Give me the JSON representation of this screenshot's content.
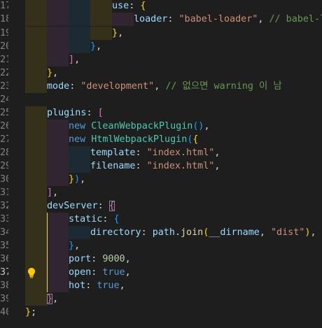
{
  "editor": {
    "line_numbers": [
      "17",
      "18",
      "19",
      "20",
      "21",
      "22",
      "23",
      "24",
      "25",
      "26",
      "27",
      "28",
      "29",
      "30",
      "31",
      "32",
      "33",
      "34",
      "35",
      "36",
      "37",
      "38",
      "39",
      "40"
    ],
    "active_line": "37",
    "gutter_icon": "lightbulb-icon",
    "colors": {
      "background": "#1e1e1e",
      "property": "#9cdcfe",
      "string": "#ce9178",
      "comment": "#6a9955",
      "number": "#b5cea8",
      "keyword": "#569cd6",
      "class": "#4ec9b0",
      "function": "#dcdcaa",
      "bracket_gold": "#ffd700",
      "bracket_orchid": "#da70d6",
      "bracket_blue": "#179fff",
      "lightbulb": "#ffcc00"
    },
    "lines": [
      {
        "tokens": [
          {
            "t": "use",
            "c": "k"
          },
          {
            "t": ": ",
            "c": "pl"
          },
          {
            "t": "{",
            "c": "p1"
          }
        ]
      },
      {
        "tokens": [
          {
            "t": "loader",
            "c": "k"
          },
          {
            "t": ": ",
            "c": "pl"
          },
          {
            "t": "\"babel-loader\"",
            "c": "s"
          },
          {
            "t": ", ",
            "c": "pl"
          },
          {
            "t": "// babel-lo",
            "c": "c"
          }
        ]
      },
      {
        "tokens": [
          {
            "t": "}",
            "c": "p1"
          },
          {
            "t": ",",
            "c": "pl"
          }
        ]
      },
      {
        "tokens": [
          {
            "t": "}",
            "c": "p3"
          },
          {
            "t": ",",
            "c": "pl"
          }
        ]
      },
      {
        "tokens": [
          {
            "t": "]",
            "c": "p2"
          },
          {
            "t": ",",
            "c": "pl"
          }
        ]
      },
      {
        "tokens": [
          {
            "t": "}",
            "c": "p1"
          },
          {
            "t": ",",
            "c": "pl"
          }
        ]
      },
      {
        "tokens": [
          {
            "t": "mode",
            "c": "k"
          },
          {
            "t": ": ",
            "c": "pl"
          },
          {
            "t": "\"development\"",
            "c": "s"
          },
          {
            "t": ", ",
            "c": "pl"
          },
          {
            "t": "// 없으면 warning 이 남",
            "c": "c"
          }
        ]
      },
      {
        "tokens": []
      },
      {
        "tokens": [
          {
            "t": "plugins",
            "c": "k"
          },
          {
            "t": ": ",
            "c": "pl"
          },
          {
            "t": "[",
            "c": "p2"
          }
        ]
      },
      {
        "tokens": [
          {
            "t": "new ",
            "c": "b"
          },
          {
            "t": "CleanWebpackPlugin",
            "c": "cl"
          },
          {
            "t": "()",
            "c": "p3"
          },
          {
            "t": ",",
            "c": "pl"
          }
        ]
      },
      {
        "tokens": [
          {
            "t": "new ",
            "c": "b"
          },
          {
            "t": "HtmlWebpackPlugin",
            "c": "cl"
          },
          {
            "t": "(",
            "c": "p3"
          },
          {
            "t": "{",
            "c": "p1"
          }
        ]
      },
      {
        "tokens": [
          {
            "t": "template",
            "c": "k"
          },
          {
            "t": ": ",
            "c": "pl"
          },
          {
            "t": "\"index.html\"",
            "c": "s"
          },
          {
            "t": ",",
            "c": "pl"
          }
        ]
      },
      {
        "tokens": [
          {
            "t": "filename",
            "c": "k"
          },
          {
            "t": ": ",
            "c": "pl"
          },
          {
            "t": "\"index.html\"",
            "c": "s"
          },
          {
            "t": ",",
            "c": "pl"
          }
        ]
      },
      {
        "tokens": [
          {
            "t": "}",
            "c": "p1"
          },
          {
            "t": ")",
            "c": "p3"
          },
          {
            "t": ",",
            "c": "pl"
          }
        ]
      },
      {
        "tokens": [
          {
            "t": "]",
            "c": "p2"
          },
          {
            "t": ",",
            "c": "pl"
          }
        ]
      },
      {
        "tokens": [
          {
            "t": "devServer",
            "c": "k"
          },
          {
            "t": ": ",
            "c": "pl"
          },
          {
            "t": "{",
            "c": "p2"
          }
        ]
      },
      {
        "tokens": [
          {
            "t": "static",
            "c": "k"
          },
          {
            "t": ": ",
            "c": "pl"
          },
          {
            "t": "{",
            "c": "p3"
          }
        ]
      },
      {
        "tokens": [
          {
            "t": "directory",
            "c": "k"
          },
          {
            "t": ": ",
            "c": "pl"
          },
          {
            "t": "path",
            "c": "v"
          },
          {
            "t": ".",
            "c": "pl"
          },
          {
            "t": "join",
            "c": "f"
          },
          {
            "t": "(",
            "c": "p1"
          },
          {
            "t": "__dirname",
            "c": "v"
          },
          {
            "t": ", ",
            "c": "pl"
          },
          {
            "t": "\"dist\"",
            "c": "s"
          },
          {
            "t": ")",
            "c": "p1"
          },
          {
            "t": ",",
            "c": "pl"
          }
        ]
      },
      {
        "tokens": [
          {
            "t": "}",
            "c": "p3"
          },
          {
            "t": ",",
            "c": "pl"
          }
        ]
      },
      {
        "tokens": [
          {
            "t": "port",
            "c": "k"
          },
          {
            "t": ": ",
            "c": "pl"
          },
          {
            "t": "9000",
            "c": "n"
          },
          {
            "t": ",",
            "c": "pl"
          }
        ]
      },
      {
        "tokens": [
          {
            "t": "open",
            "c": "k"
          },
          {
            "t": ": ",
            "c": "pl"
          },
          {
            "t": "true",
            "c": "b"
          },
          {
            "t": ",",
            "c": "pl"
          }
        ]
      },
      {
        "tokens": [
          {
            "t": "hot",
            "c": "k"
          },
          {
            "t": ": ",
            "c": "pl"
          },
          {
            "t": "true",
            "c": "b"
          },
          {
            "t": ",",
            "c": "pl"
          }
        ]
      },
      {
        "tokens": [
          {
            "t": "}",
            "c": "p2"
          },
          {
            "t": ",",
            "c": "pl"
          }
        ]
      },
      {
        "tokens": [
          {
            "t": "}",
            "c": "p1"
          },
          {
            "t": ";",
            "c": "pl"
          }
        ]
      }
    ]
  }
}
